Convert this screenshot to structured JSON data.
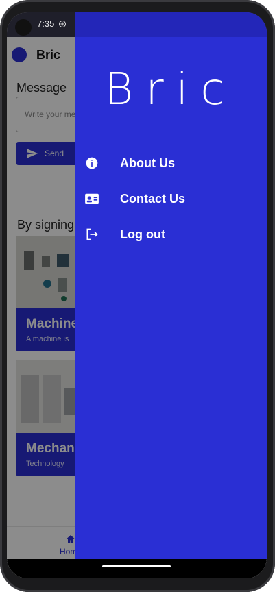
{
  "status_bar": {
    "time": "7:35"
  },
  "app": {
    "title": "Bric",
    "message_label": "Message",
    "message_placeholder": "Write your message",
    "send_label": "Send",
    "signing_text": "By signing",
    "cards": [
      {
        "title": "Machine",
        "subtitle": "A machine is"
      },
      {
        "title": "Mechan",
        "subtitle": "Technology"
      }
    ],
    "bottom_nav": {
      "home_label": "Home"
    }
  },
  "drawer": {
    "brand": "Bric",
    "items": [
      {
        "label": "About Us",
        "icon": "info-icon"
      },
      {
        "label": "Contact Us",
        "icon": "contact-card-icon"
      },
      {
        "label": "Log out",
        "icon": "logout-icon"
      }
    ]
  },
  "colors": {
    "primary": "#2a2fd4",
    "drawer_top": "#2326b8",
    "scrim": "rgba(0,0,0,0.45)"
  }
}
